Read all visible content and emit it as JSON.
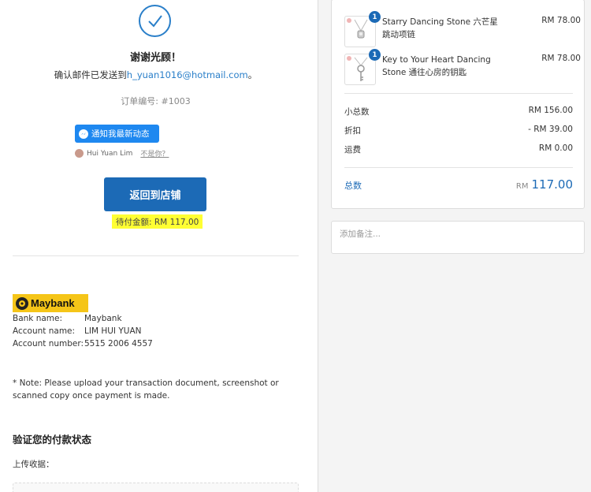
{
  "confirmation": {
    "thanks": "谢谢光顾！",
    "email_prefix": "确认邮件已发送到",
    "email": "h_yuan1016@hotmail.com",
    "email_suffix": "。",
    "order_number": "订单编号: #1003"
  },
  "messenger": {
    "button_label": "通知我最新动态",
    "user_name": "Hui Yuan Lim",
    "not_you": "不是你？"
  },
  "actions": {
    "back_to_store": "返回到店铺",
    "pending_amount": "待付金额: RM 117.00"
  },
  "bank": {
    "logo_text": "Maybank",
    "rows": [
      {
        "key": "Bank name:",
        "value": "Maybank"
      },
      {
        "key": "Account name:",
        "value": "LIM HUI YUAN"
      },
      {
        "key": "Account number:",
        "value": "5515 2006 4557"
      }
    ],
    "note": "* Note: Please upload your transaction document, screenshot or scanned copy once payment is made."
  },
  "verify": {
    "title": "验证您的付款状态",
    "upload_label": "上传收据："
  },
  "order_summary": {
    "items": [
      {
        "name": "Starry Dancing Stone 六芒星跳动项链",
        "quantity": "1",
        "price": "RM 78.00"
      },
      {
        "name": "Key to Your Heart Dancing Stone 通往心房的钥匙",
        "quantity": "1",
        "price": "RM 78.00"
      }
    ],
    "subtotal_label": "小总数",
    "subtotal": "RM 156.00",
    "discount_label": "折扣",
    "discount": "- RM 39.00",
    "shipping_label": "运费",
    "shipping": "RM 0.00",
    "total_label": "总数",
    "total_currency": "RM",
    "total_value": "117.00"
  },
  "notes": {
    "placeholder": "添加备注..."
  },
  "colors": {
    "accent": "#1c6ab6",
    "messenger": "#1e88f0",
    "highlight": "#ffff33",
    "maybank": "#f5c518"
  }
}
